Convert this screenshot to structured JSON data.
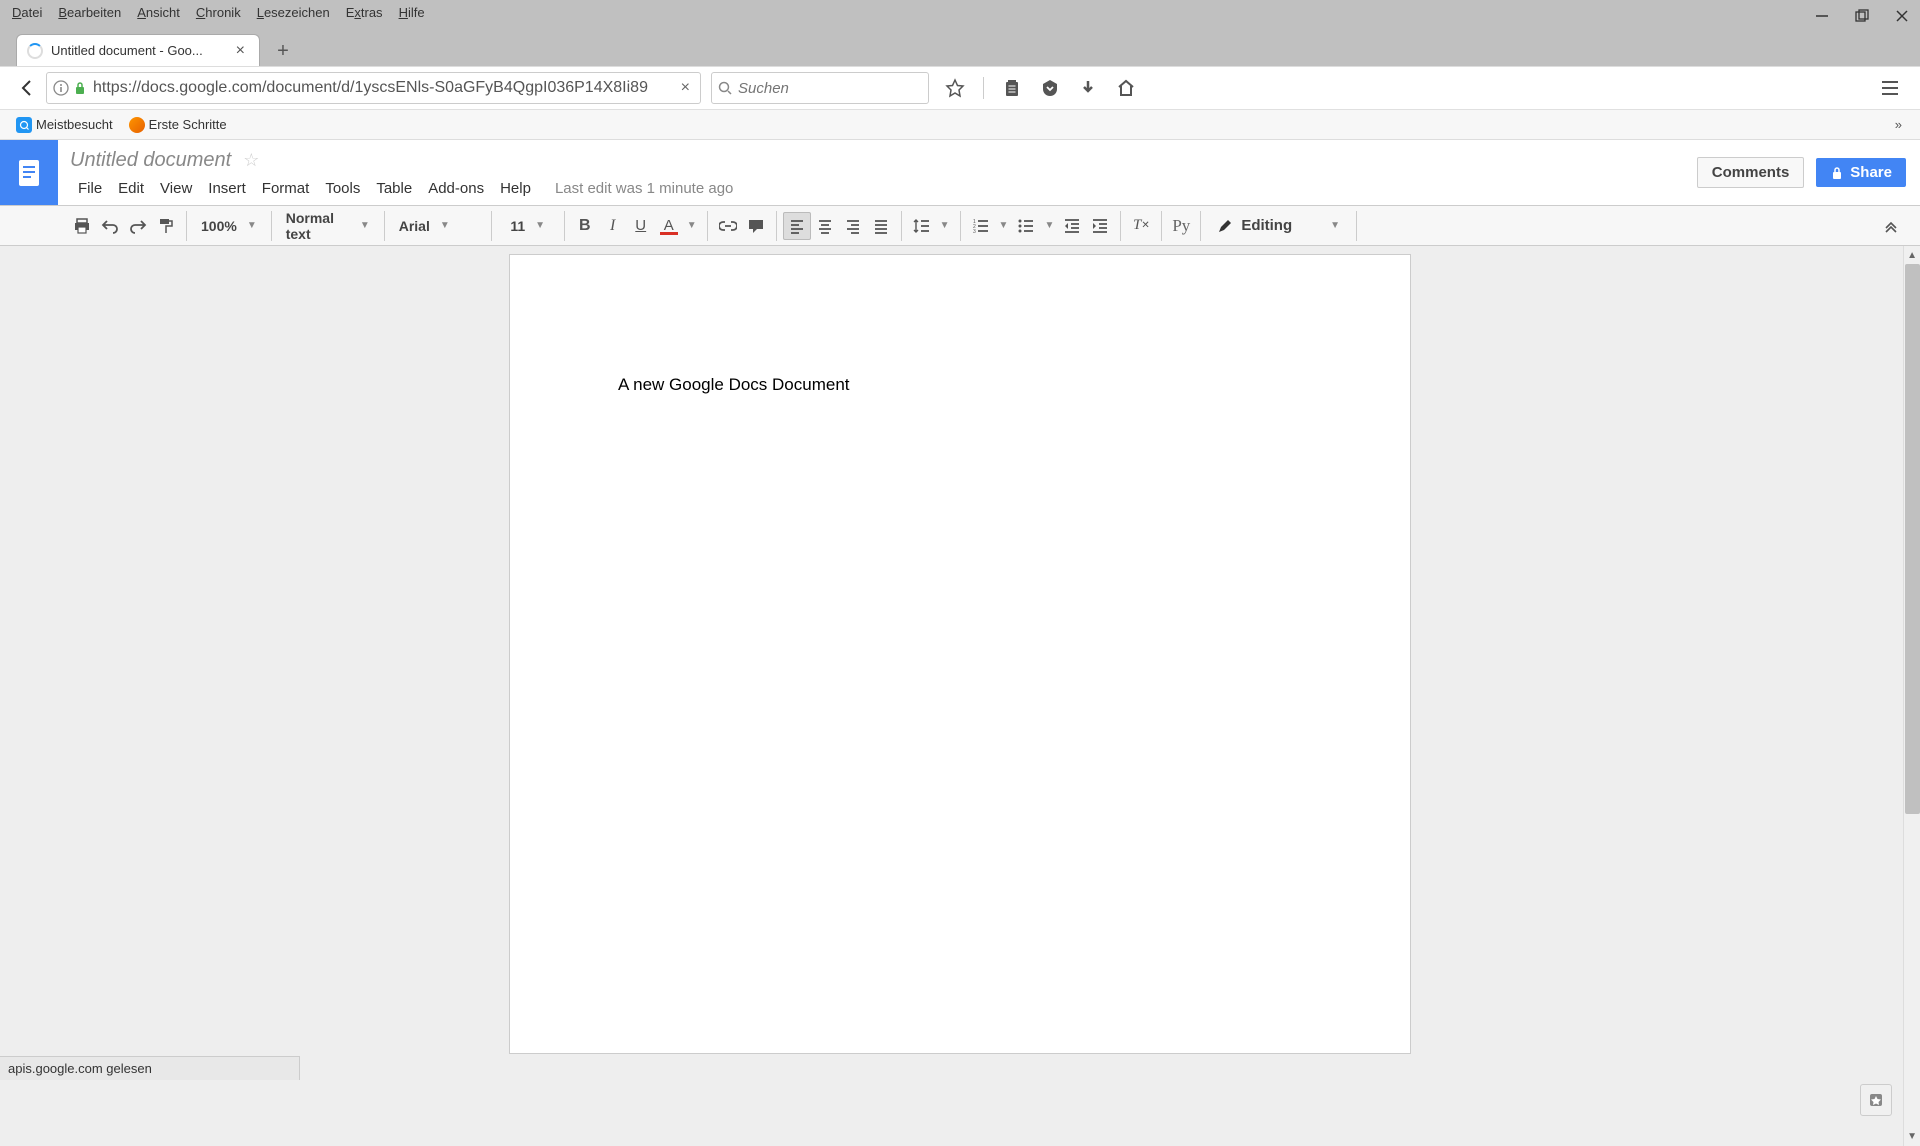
{
  "browser_menu": [
    "Datei",
    "Bearbeiten",
    "Ansicht",
    "Chronik",
    "Lesezeichen",
    "Extras",
    "Hilfe"
  ],
  "tab": {
    "title": "Untitled document - Goo..."
  },
  "url": "https://docs.google.com/document/d/1yscsENls-S0aGFyB4QgpI036P14X8Ii89",
  "search_placeholder": "Suchen",
  "bookmarks": [
    {
      "label": "Meistbesucht"
    },
    {
      "label": "Erste Schritte"
    }
  ],
  "docs": {
    "title": "Untitled document",
    "menus": [
      "File",
      "Edit",
      "View",
      "Insert",
      "Format",
      "Tools",
      "Table",
      "Add-ons",
      "Help"
    ],
    "status": "Last edit was 1 minute ago",
    "comments_btn": "Comments",
    "share_btn": "Share",
    "toolbar": {
      "zoom": "100%",
      "style": "Normal text",
      "font": "Arial",
      "size": "11",
      "editing_mode": "Editing",
      "spellcheck": "Py"
    },
    "content": "A new Google Docs Document"
  },
  "status_text": "apis.google.com gelesen"
}
